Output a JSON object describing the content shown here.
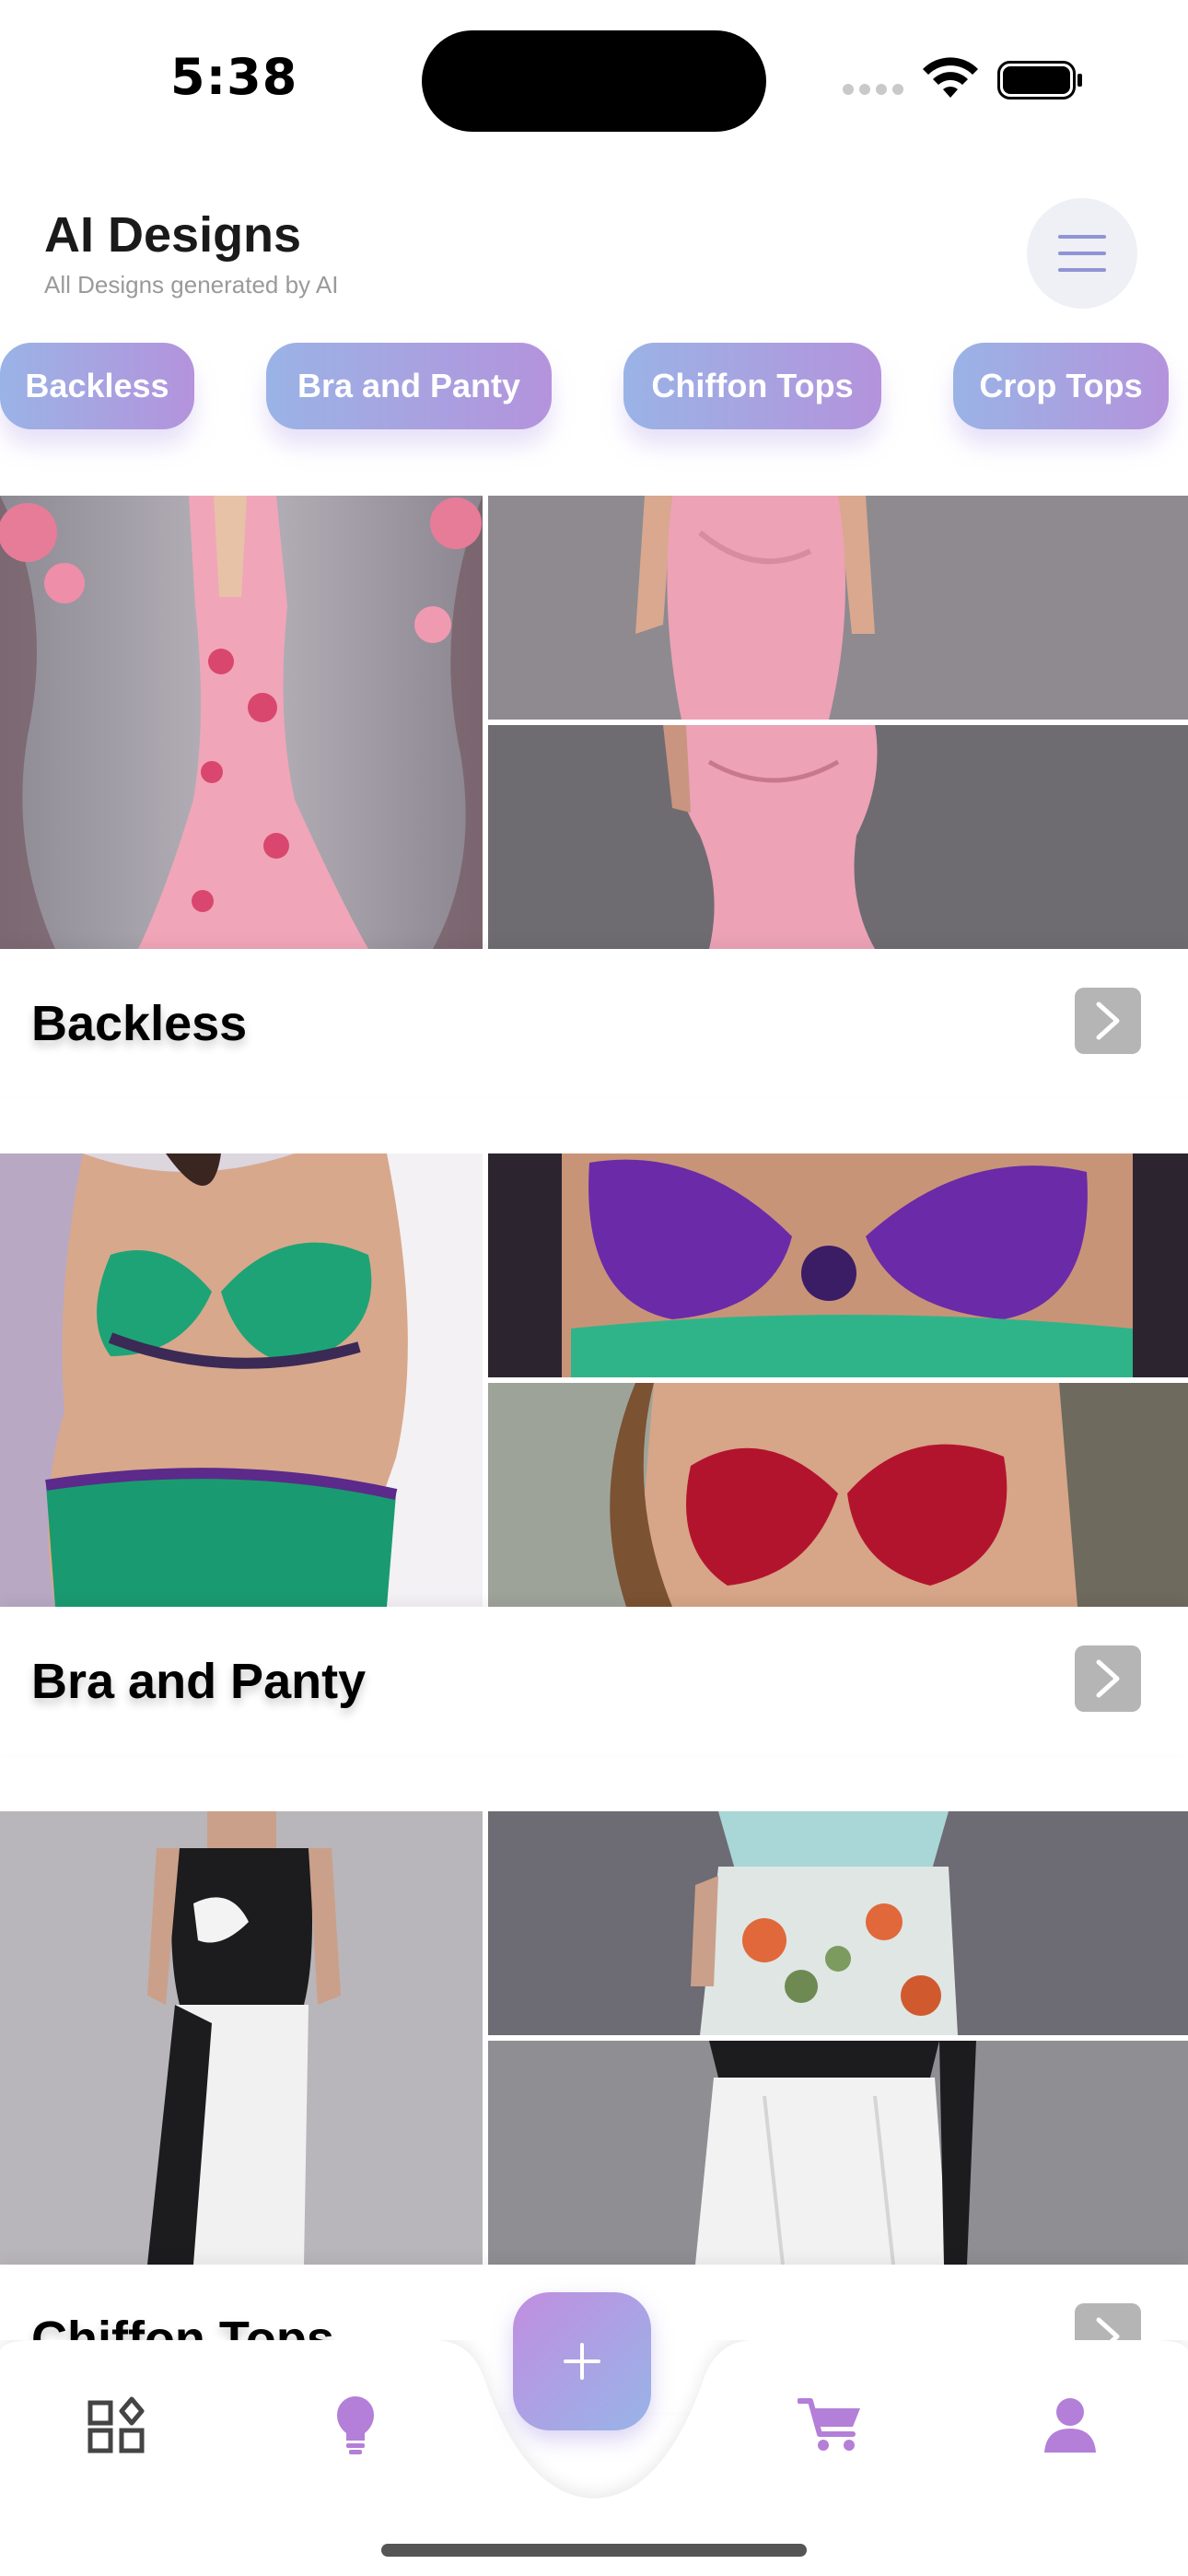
{
  "status_bar": {
    "time": "5:38"
  },
  "header": {
    "title": "AI Designs",
    "subtitle": "All Designs generated by AI"
  },
  "chips": [
    {
      "label": "Backless"
    },
    {
      "label": "Bra and Panty"
    },
    {
      "label": "Chiffon Tops"
    },
    {
      "label": "Crop Tops"
    }
  ],
  "sections": [
    {
      "title": "Backless"
    },
    {
      "title": "Bra and Panty"
    },
    {
      "title": "Chiffon Tops"
    }
  ],
  "bottom_nav": {
    "items": [
      {
        "icon": "categories-icon"
      },
      {
        "icon": "lightbulb-icon"
      },
      {
        "icon": "plus-icon"
      },
      {
        "icon": "cart-icon"
      },
      {
        "icon": "user-icon"
      }
    ]
  },
  "colors": {
    "accent_purple": "#b47fd8",
    "accent_blue": "#9ab3e6",
    "chip_gradient_start": "#9ab3e6",
    "chip_gradient_end": "#b493dc"
  }
}
